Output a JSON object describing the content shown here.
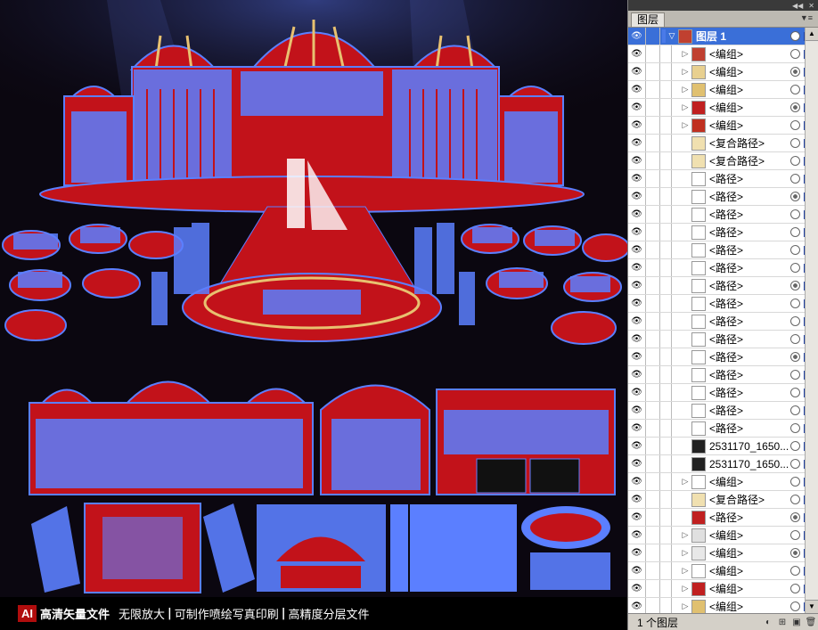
{
  "caption": {
    "badge": "AI",
    "text1": "高清矢量文件",
    "text2": "无限放大",
    "text3": "可制作喷绘写真印刷",
    "text4": "高精度分层文件",
    "sep": "|"
  },
  "layers_panel": {
    "tab": "图层",
    "layer_count": "1 个图层",
    "top_layer": "图层 1",
    "items": [
      {
        "name": "<编组>",
        "expand": true,
        "thumb": "#c04030",
        "target": "ring"
      },
      {
        "name": "<编组>",
        "expand": true,
        "thumb": "#e8d090",
        "target": "solid"
      },
      {
        "name": "<编组>",
        "expand": true,
        "thumb": "#e0c070",
        "target": "ring"
      },
      {
        "name": "<编组>",
        "expand": true,
        "thumb": "#c02020",
        "target": "solid"
      },
      {
        "name": "<编组>",
        "expand": true,
        "thumb": "#c03020",
        "target": "ring"
      },
      {
        "name": "<复合路径>",
        "expand": false,
        "thumb": "#f0e0b0",
        "target": "ring"
      },
      {
        "name": "<复合路径>",
        "expand": false,
        "thumb": "#f0e0b0",
        "target": "ring"
      },
      {
        "name": "<路径>",
        "expand": false,
        "thumb": "#ffffff",
        "target": "ring"
      },
      {
        "name": "<路径>",
        "expand": false,
        "thumb": "#ffffff",
        "target": "solid"
      },
      {
        "name": "<路径>",
        "expand": false,
        "thumb": "#ffffff",
        "target": "ring"
      },
      {
        "name": "<路径>",
        "expand": false,
        "thumb": "#ffffff",
        "target": "ring"
      },
      {
        "name": "<路径>",
        "expand": false,
        "thumb": "#ffffff",
        "target": "ring"
      },
      {
        "name": "<路径>",
        "expand": false,
        "thumb": "#ffffff",
        "target": "ring"
      },
      {
        "name": "<路径>",
        "expand": false,
        "thumb": "#ffffff",
        "target": "solid"
      },
      {
        "name": "<路径>",
        "expand": false,
        "thumb": "#ffffff",
        "target": "ring"
      },
      {
        "name": "<路径>",
        "expand": false,
        "thumb": "#ffffff",
        "target": "ring"
      },
      {
        "name": "<路径>",
        "expand": false,
        "thumb": "#ffffff",
        "target": "ring"
      },
      {
        "name": "<路径>",
        "expand": false,
        "thumb": "#ffffff",
        "target": "solid"
      },
      {
        "name": "<路径>",
        "expand": false,
        "thumb": "#ffffff",
        "target": "ring"
      },
      {
        "name": "<路径>",
        "expand": false,
        "thumb": "#ffffff",
        "target": "ring"
      },
      {
        "name": "<路径>",
        "expand": false,
        "thumb": "#ffffff",
        "target": "ring"
      },
      {
        "name": "<路径>",
        "expand": false,
        "thumb": "#ffffff",
        "target": "ring"
      },
      {
        "name": "2531170_1650...",
        "expand": false,
        "thumb": "#222222",
        "target": "ring"
      },
      {
        "name": "2531170_1650...",
        "expand": false,
        "thumb": "#222222",
        "target": "ring"
      },
      {
        "name": "<编组>",
        "expand": true,
        "thumb": "#ffffff",
        "target": "ring"
      },
      {
        "name": "<复合路径>",
        "expand": false,
        "thumb": "#f0e0b0",
        "target": "ring"
      },
      {
        "name": "<路径>",
        "expand": false,
        "thumb": "#c02020",
        "target": "solid"
      },
      {
        "name": "<编组>",
        "expand": true,
        "thumb": "#e0e0e0",
        "target": "ring"
      },
      {
        "name": "<编组>",
        "expand": true,
        "thumb": "#e8e8e8",
        "target": "solid"
      },
      {
        "name": "<编组>",
        "expand": true,
        "thumb": "#ffffff",
        "target": "ring"
      },
      {
        "name": "<编组>",
        "expand": true,
        "thumb": "#c02020",
        "target": "ring"
      },
      {
        "name": "<编组>",
        "expand": true,
        "thumb": "#e0c070",
        "target": "ring"
      }
    ]
  },
  "colors": {
    "selection_blue": "#5b7fff",
    "carpet_red": "#c2121a",
    "gold": "#e8c170",
    "panel_selected": "#3a6fd8"
  }
}
